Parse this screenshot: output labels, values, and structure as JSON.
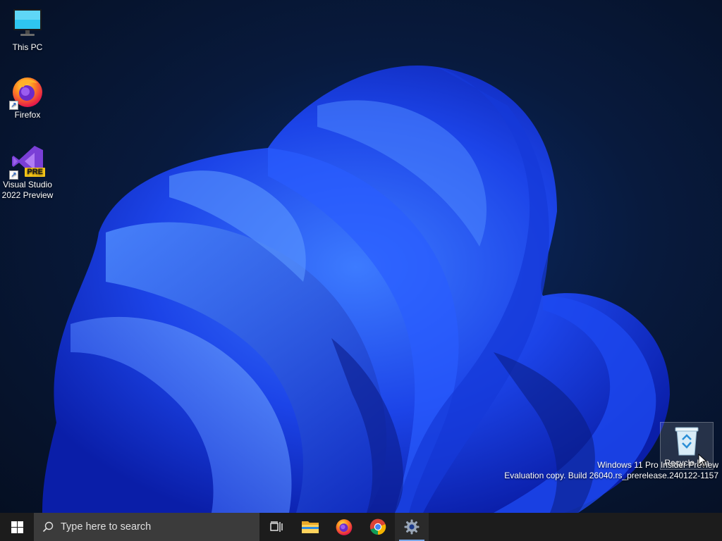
{
  "desktop": {
    "icons": [
      {
        "label": "This PC"
      },
      {
        "label": "Firefox"
      },
      {
        "label": "Visual Studio 2022 Preview",
        "badge": "PRE"
      },
      {
        "label": "Recycle Bin"
      }
    ],
    "watermark": {
      "line1": "Windows 11 Pro Insider Preview",
      "line2": "Evaluation copy. Build 26040.rs_prerelease.240122-1157"
    }
  },
  "taskbar": {
    "search_placeholder": "Type here to search",
    "pinned": [
      "task-view-icon",
      "file-explorer-icon",
      "firefox-icon",
      "chrome-icon",
      "settings-icon"
    ],
    "active": "settings-icon"
  },
  "colors": {
    "taskbar": "#1c1c1c",
    "search_box": "#3b3b3b",
    "accent": "#7aa7e8",
    "wallpaper_bloom": "#1f4df0"
  }
}
